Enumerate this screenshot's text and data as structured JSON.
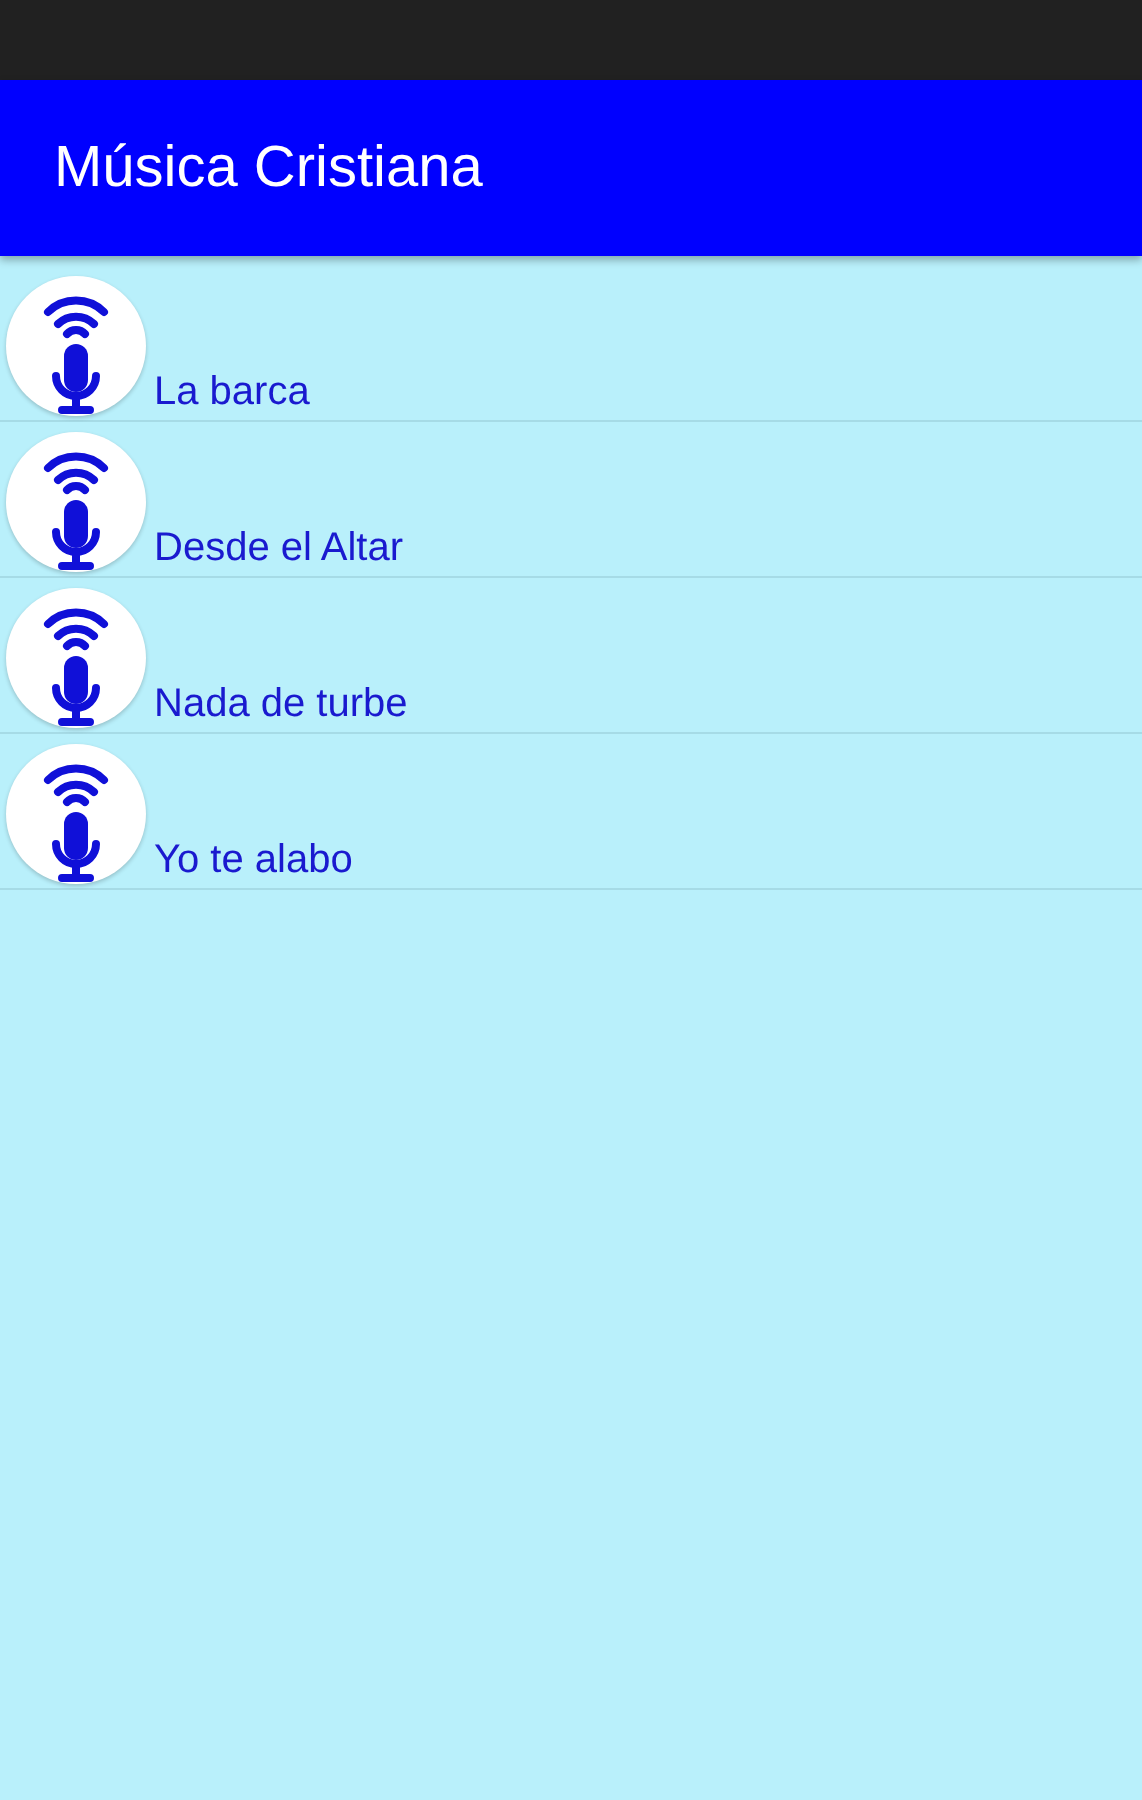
{
  "app_bar": {
    "title": "Música Cristiana"
  },
  "songs": [
    {
      "title": "La barca"
    },
    {
      "title": "Desde el Altar"
    },
    {
      "title": "Nada de turbe"
    },
    {
      "title": "Yo te alabo"
    }
  ]
}
